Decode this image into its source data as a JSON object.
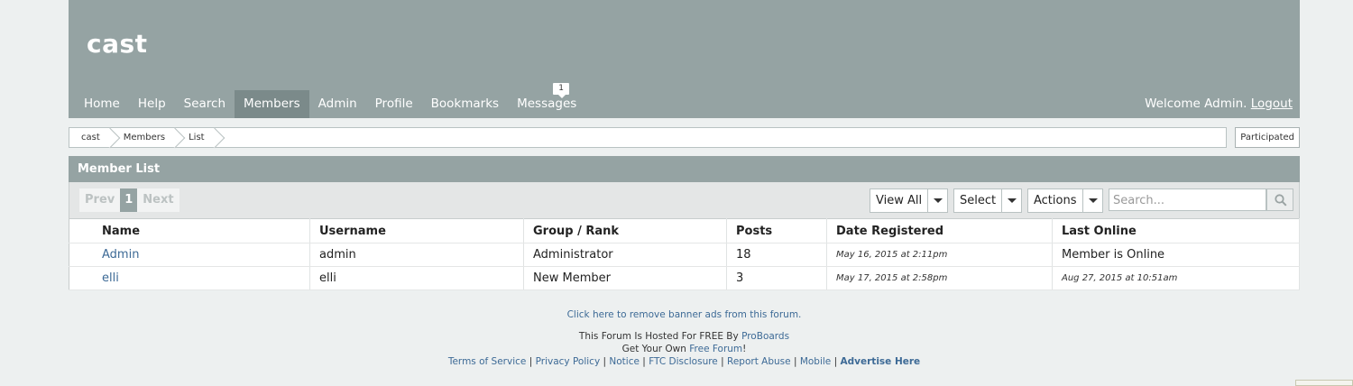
{
  "site": {
    "title": "cast"
  },
  "nav": {
    "items": [
      "Home",
      "Help",
      "Search",
      "Members",
      "Admin",
      "Profile",
      "Bookmarks",
      "Messages"
    ],
    "messages_badge": "1",
    "welcome_prefix": "Welcome Admin.",
    "logout": "Logout"
  },
  "breadcrumb": [
    "cast",
    "Members",
    "List"
  ],
  "participated_button": "Participated",
  "panel": {
    "title": "Member List",
    "pager": {
      "prev": "Prev",
      "current": "1",
      "next": "Next"
    },
    "view_all": "View All",
    "select": "Select",
    "actions": "Actions",
    "search_placeholder": "Search..."
  },
  "table": {
    "headers": [
      "Name",
      "Username",
      "Group / Rank",
      "Posts",
      "Date Registered",
      "Last Online"
    ],
    "rows": [
      {
        "name": "Admin",
        "username": "admin",
        "group": "Administrator",
        "posts": "18",
        "registered": "May 16, 2015 at 2:11pm",
        "last_online": "Member is Online"
      },
      {
        "name": "elli",
        "username": "elli",
        "group": "New Member",
        "posts": "3",
        "registered": "May 17, 2015 at 2:58pm",
        "last_online": "Aug 27, 2015 at 10:51am"
      }
    ]
  },
  "footer": {
    "remove_ads": "Click here to remove banner ads from this forum.",
    "hosted_prefix": "This Forum Is Hosted For FREE By",
    "hosted_link": "ProBoards",
    "get_own_prefix": "Get Your Own",
    "get_own_link": "Free Forum",
    "get_own_suffix": "!",
    "links": [
      "Terms of Service",
      "Privacy Policy",
      "Notice",
      "FTC Disclosure",
      "Report Abuse",
      "Mobile",
      "Advertise Here"
    ],
    "separator": "|"
  },
  "colors": {
    "header": "#95a3a3",
    "active_nav": "#7b8a8a",
    "link": "#3d6a96",
    "background": "#edf0f0"
  }
}
